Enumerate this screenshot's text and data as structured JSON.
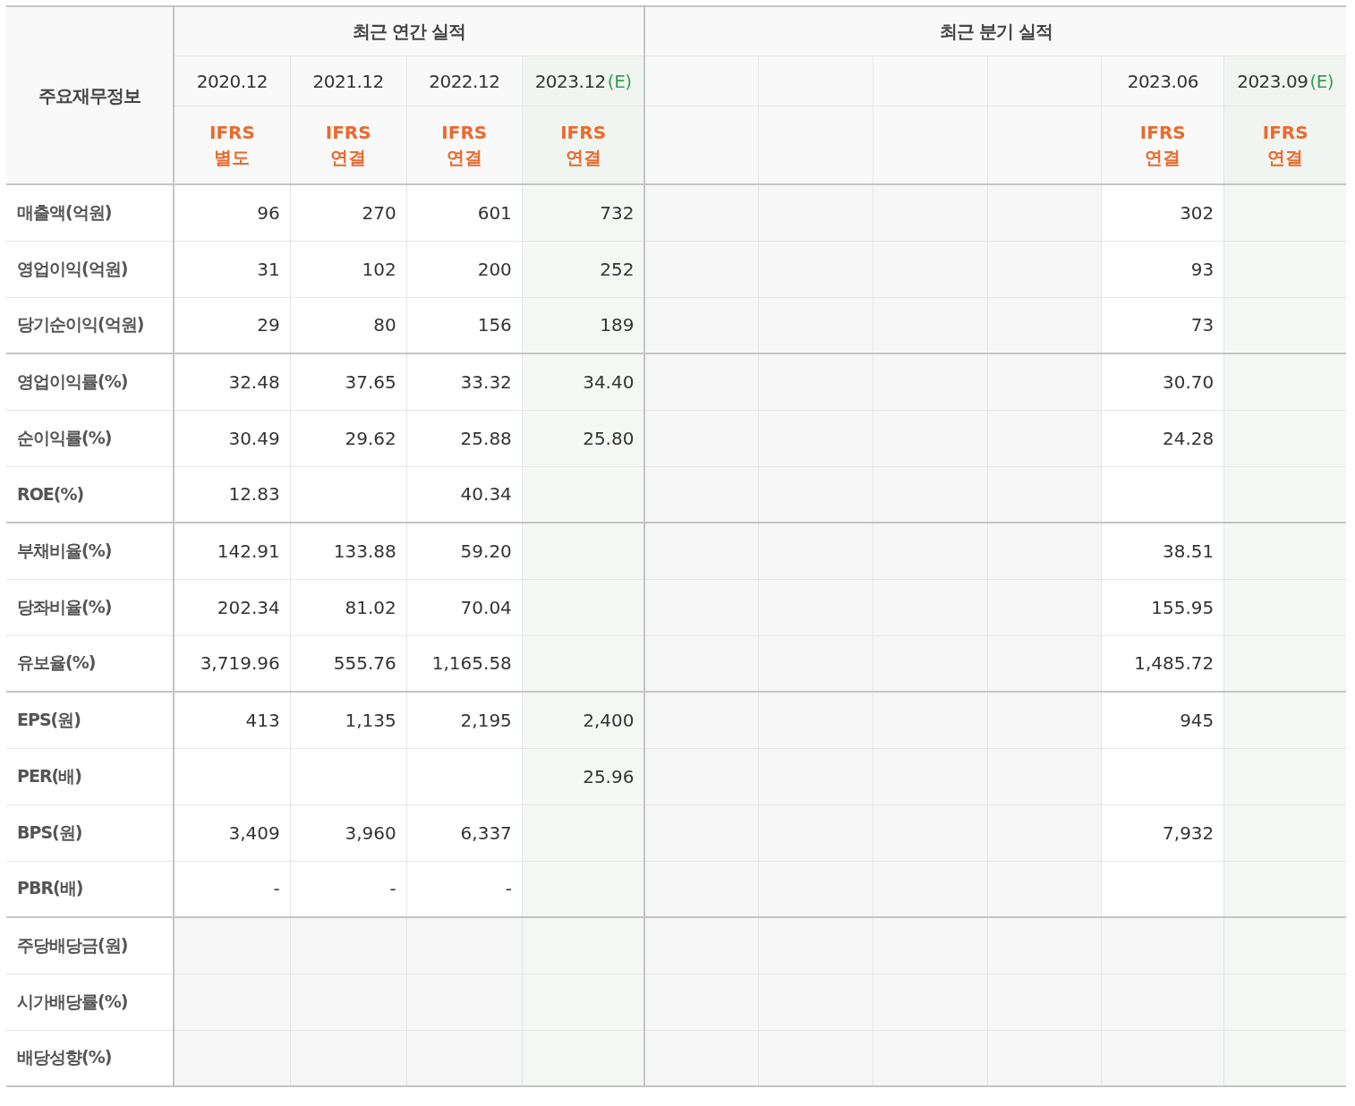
{
  "table": {
    "corner_header": "주요재무정보",
    "groups": [
      {
        "title": "최근 연간 실적",
        "columns": [
          {
            "period": "2020.12",
            "standard": [
              "IFRS",
              "별도"
            ]
          },
          {
            "period": "2021.12",
            "standard": [
              "IFRS",
              "연결"
            ]
          },
          {
            "period": "2022.12",
            "standard": [
              "IFRS",
              "연결"
            ]
          },
          {
            "period": "2023.12",
            "estimate_mark": "(E)",
            "standard": [
              "IFRS",
              "연결"
            ]
          }
        ]
      },
      {
        "title": "최근 분기 실적",
        "columns": [
          {},
          {},
          {},
          {},
          {
            "period": "2023.06",
            "standard": [
              "IFRS",
              "연결"
            ]
          },
          {
            "period": "2023.09",
            "estimate_mark": "(E)",
            "standard": [
              "IFRS",
              "연결"
            ]
          }
        ]
      }
    ],
    "row_groups": [
      [
        {
          "label": "매출액(억원)",
          "cells": {
            "column_1": "96",
            "column_2": "270",
            "column_3": "601",
            "column_4": "732",
            "column_9": "302"
          }
        },
        {
          "label": "영업이익(억원)",
          "cells": {
            "column_1": "31",
            "column_2": "102",
            "column_3": "200",
            "column_4": "252",
            "column_9": "93"
          }
        },
        {
          "label": "당기순이익(억원)",
          "cells": {
            "column_1": "29",
            "column_2": "80",
            "column_3": "156",
            "column_4": "189",
            "column_9": "73"
          }
        }
      ],
      [
        {
          "label": "영업이익률(%)",
          "cells": {
            "column_1": "32.48",
            "column_2": "37.65",
            "column_3": "33.32",
            "column_4": "34.40",
            "column_9": "30.70"
          }
        },
        {
          "label": "순이익률(%)",
          "cells": {
            "column_1": "30.49",
            "column_2": "29.62",
            "column_3": "25.88",
            "column_4": "25.80",
            "column_9": "24.28"
          }
        },
        {
          "label": "ROE(%)",
          "cells": {
            "column_1": "12.83",
            "column_3": "40.34"
          }
        }
      ],
      [
        {
          "label": "부채비율(%)",
          "cells": {
            "column_1": "142.91",
            "column_2": "133.88",
            "column_3": "59.20",
            "column_9": "38.51"
          }
        },
        {
          "label": "당좌비율(%)",
          "cells": {
            "column_1": "202.34",
            "column_2": "81.02",
            "column_3": "70.04",
            "column_9": "155.95"
          }
        },
        {
          "label": "유보율(%)",
          "cells": {
            "column_1": "3,719.96",
            "column_2": "555.76",
            "column_3": "1,165.58",
            "column_9": "1,485.72"
          }
        }
      ],
      [
        {
          "label": "EPS(원)",
          "cells": {
            "column_1": "413",
            "column_2": "1,135",
            "column_3": "2,195",
            "column_4": "2,400",
            "column_9": "945"
          }
        },
        {
          "label": "PER(배)",
          "cells": {
            "column_4": "25.96"
          }
        },
        {
          "label": "BPS(원)",
          "cells": {
            "column_1": "3,409",
            "column_2": "3,960",
            "column_3": "6,337",
            "column_9": "7,932"
          }
        },
        {
          "label": "PBR(배)",
          "cells": {
            "column_1": "-",
            "column_2": "-",
            "column_3": "-"
          }
        }
      ],
      [
        {
          "label": "주당배당금(원)"
        },
        {
          "label": "시가배당률(%)"
        },
        {
          "label": "배당성향(%)"
        }
      ]
    ]
  }
}
